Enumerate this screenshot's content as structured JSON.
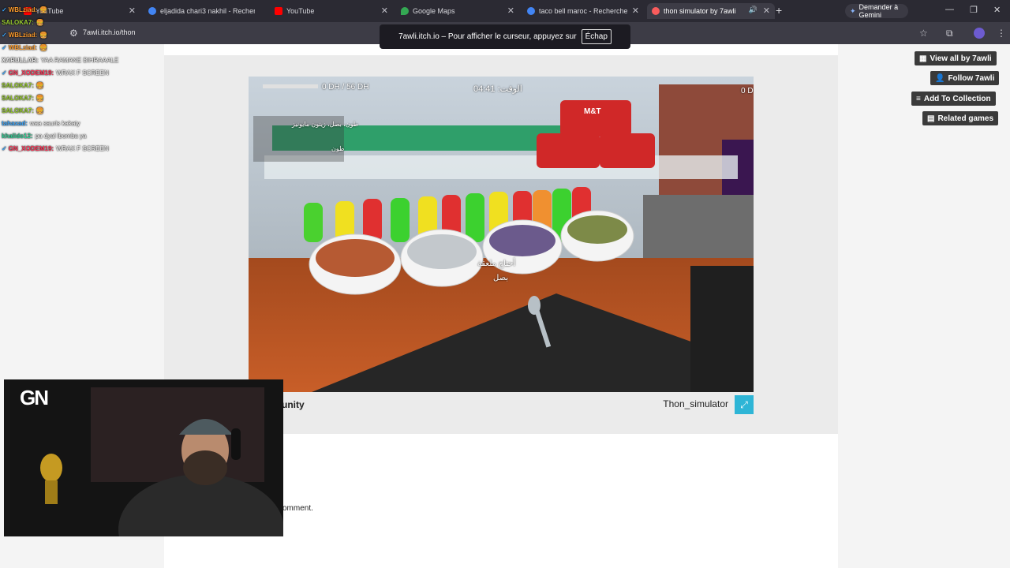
{
  "browser": {
    "tabs": [
      {
        "title": "YouTube",
        "favicon_color": "#ff0000"
      },
      {
        "title": "eljadida chari3 nakhil - Recherche",
        "favicon_color": "#4285f4"
      },
      {
        "title": "YouTube",
        "favicon_color": "#ff0000"
      },
      {
        "title": "Google Maps",
        "favicon_color": "#34a853"
      },
      {
        "title": "taco bell maroc - Recherche Go",
        "favicon_color": "#4285f4"
      },
      {
        "title": "thon simulator by 7awli",
        "favicon_color": "#fa5c5c",
        "active": true
      }
    ],
    "new_tab": "+",
    "gemini_label": "Demander à Gemini",
    "url": "7awli.itch.io/thon",
    "fullscreen_toast": "7awli.itch.io – Pour afficher le curseur, appuyez sur",
    "fullscreen_key": "Échap"
  },
  "sidebar": {
    "buttons": [
      {
        "label": "View all by 7awli",
        "icon": "store-icon"
      },
      {
        "label": "Follow 7awli",
        "icon": "user-plus-icon"
      },
      {
        "label": "Add To Collection",
        "icon": "list-add-icon"
      },
      {
        "label": "Related games",
        "icon": "map-icon"
      }
    ]
  },
  "game": {
    "money": "0 DH / 56 DH",
    "time": "الوقت: 04:41",
    "money_right": "0 D",
    "order_hint": "طون، بصل، زيتون مايونيز",
    "order_item": "طون",
    "need_line1": "أحتاج ملعقة",
    "need_line2": "بصل",
    "can_label": "M&T",
    "title": "Thon_simulator",
    "engine": "unity"
  },
  "page": {
    "comment_fragment": "omment."
  },
  "chat": [
    {
      "user": "WBLziad:",
      "color": "#ff9d2e",
      "msg": "🍔",
      "badge": "✓"
    },
    {
      "user": "SALOKA7:",
      "color": "#9acd32",
      "msg": "🍔"
    },
    {
      "user": "WBLziad:",
      "color": "#ff9d2e",
      "msg": "🍔",
      "badge": "✓"
    },
    {
      "user": "WBLziad:",
      "color": "#ff9d2e",
      "msg": "🍔",
      "badge": "✓"
    },
    {
      "user": "XARULLAR:",
      "color": "#eaeaea",
      "msg": "YAA RAMANE BIHRAAALE"
    },
    {
      "user": "GN_XODEM19:",
      "color": "#ff3b5c",
      "msg": "WRAX F SCREEN",
      "badge": "✓"
    },
    {
      "user": "SALOKA7:",
      "color": "#9acd32",
      "msg": "🍔"
    },
    {
      "user": "SALOKA7:",
      "color": "#9acd32",
      "msg": "🍔"
    },
    {
      "user": "SALOKA7:",
      "color": "#9acd32",
      "msg": "🍔"
    },
    {
      "user": "tahaxad:",
      "color": "#3ea9ff",
      "msg": "waa sauris kakaty"
    },
    {
      "user": "khalido12:",
      "color": "#34d399",
      "msg": "pa dyal lbomba ya"
    },
    {
      "user": "GN_XODEM19:",
      "color": "#ff3b5c",
      "msg": "WRAX F SCREEN",
      "badge": "✓"
    }
  ],
  "webcam": {
    "logo": "GN"
  }
}
